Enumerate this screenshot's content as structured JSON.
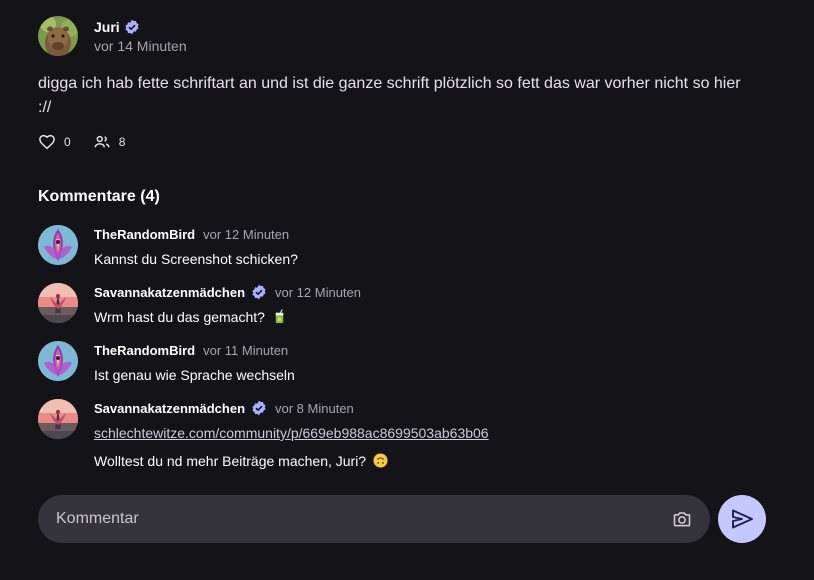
{
  "post": {
    "author": "Juri",
    "time": "vor 14 Minuten",
    "text": "digga ich hab fette schriftart an und ist die ganze schrift plötzlich so fett das war vorher nicht so hier ://",
    "likes": "0",
    "reactions": "8",
    "avatar_icon": "capybara-avatar",
    "verified_icon": "verified-badge-icon"
  },
  "comments_title": "Kommentare (4)",
  "comments": [
    {
      "author": "TheRandomBird",
      "time": "vor 12 Minuten",
      "text": "Kannst du Screenshot schicken?",
      "avatar_icon": "bird-art-avatar",
      "verified": false
    },
    {
      "author": "Savannakatzenmädchen",
      "time": "vor 12 Minuten",
      "text": "Wrm hast du das gemacht?",
      "emoji": "juice-box-emoji",
      "avatar_icon": "sunset-art-avatar",
      "verified": true
    },
    {
      "author": "TheRandomBird",
      "time": "vor 11 Minuten",
      "text": "Ist genau wie Sprache wechseln",
      "avatar_icon": "bird-art-avatar",
      "verified": false
    },
    {
      "author": "Savannakatzenmädchen",
      "time": "vor 8 Minuten",
      "link": "schlechtewitze.com/community/p/669eb988ac8699503ab63b06",
      "text": "Wolltest du nd mehr Beiträge machen, Juri?",
      "emoji": "upside-down-face-emoji",
      "avatar_icon": "sunset-art-avatar",
      "verified": true
    }
  ],
  "composer": {
    "placeholder": "Kommentar",
    "camera_icon": "camera-icon",
    "send_icon": "send-icon"
  },
  "colors": {
    "background": "#131318",
    "accent": "#c4c8ff",
    "verified": "#a9b0ff",
    "input_bg": "#35343a"
  }
}
